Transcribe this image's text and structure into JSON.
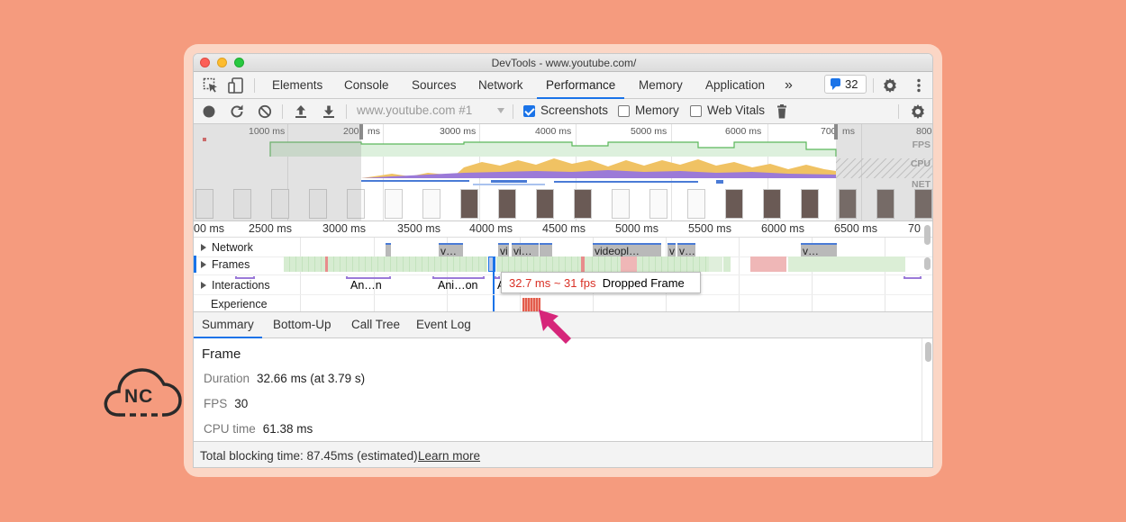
{
  "window": {
    "title": "DevTools - www.youtube.com/"
  },
  "panel_tabs": [
    {
      "label": "Elements"
    },
    {
      "label": "Console"
    },
    {
      "label": "Sources"
    },
    {
      "label": "Network"
    },
    {
      "label": "Performance",
      "active": true
    },
    {
      "label": "Memory"
    },
    {
      "label": "Application"
    }
  ],
  "more_tabs_glyph": "»",
  "messages": {
    "count": "32"
  },
  "toolbar": {
    "url": "www.youtube.com #1",
    "screenshots_label": "Screenshots",
    "screenshots_checked": true,
    "memory_label": "Memory",
    "memory_checked": false,
    "webvitals_label": "Web Vitals",
    "webvitals_checked": false
  },
  "overview": {
    "ticks": [
      "1000 ms",
      "200",
      "ms",
      "3000 ms",
      "4000 ms",
      "5000 ms",
      "6000 ms",
      "700",
      "ms",
      "800"
    ],
    "lanes": [
      "FPS",
      "CPU",
      "NET"
    ]
  },
  "ruler": {
    "ticks": [
      "00 ms",
      "2500 ms",
      "3000 ms",
      "3500 ms",
      "4000 ms",
      "4500 ms",
      "5000 ms",
      "5500 ms",
      "6000 ms",
      "6500 ms",
      "70"
    ]
  },
  "tracks": {
    "network": "Network",
    "frames": "Frames",
    "interactions": "Interactions",
    "experience": "Experience",
    "network_bars": [
      "v…",
      "vi",
      "vi…",
      "videopl…",
      "v",
      "v…",
      "v…"
    ],
    "interaction_bars": [
      "An…n",
      "Ani…on",
      "A"
    ]
  },
  "tooltip": {
    "timing": "32.7 ms ~ 31 fps",
    "label": "Dropped Frame"
  },
  "bottom_tabs": [
    {
      "label": "Summary",
      "active": true
    },
    {
      "label": "Bottom-Up"
    },
    {
      "label": "Call Tree"
    },
    {
      "label": "Event Log"
    }
  ],
  "summary": {
    "title": "Frame",
    "duration_key": "Duration",
    "duration_value": "32.66 ms (at 3.79 s)",
    "fps_key": "FPS",
    "fps_value": "30",
    "cpu_key": "CPU time",
    "cpu_value": "61.38 ms"
  },
  "footer": {
    "text": "Total blocking time: 87.45ms (estimated)",
    "link": "Learn more"
  },
  "logo": {
    "text": "NC"
  },
  "colors": {
    "background": "#f59b7e",
    "accent": "#1a73e8",
    "dropped_frame": "#d93025",
    "arrow": "#d6267a"
  }
}
